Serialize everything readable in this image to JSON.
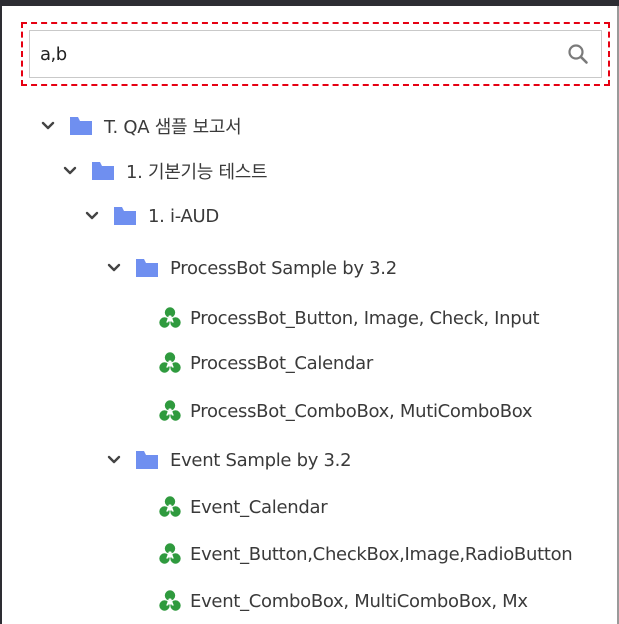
{
  "search": {
    "value": "a,b",
    "placeholder": ""
  },
  "colors": {
    "highlight": "#e60012",
    "folder": "#6f8ff0",
    "report_icon": "#2f9a3e",
    "text": "#3a3a3a"
  },
  "tree": {
    "items": [
      {
        "label": "T. QA 샘플 보고서",
        "type": "folder",
        "expanded": true
      },
      {
        "label": "1. 기본기능 테스트",
        "type": "folder",
        "expanded": true
      },
      {
        "label": "1. i-AUD",
        "type": "folder",
        "expanded": true
      },
      {
        "label": "ProcessBot Sample by 3.2",
        "type": "folder",
        "expanded": true
      },
      {
        "label": "ProcessBot_Button, Image, Check, Input",
        "type": "report"
      },
      {
        "label": "ProcessBot_Calendar",
        "type": "report"
      },
      {
        "label": "ProcessBot_ComboBox, MutiComboBox",
        "type": "report"
      },
      {
        "label": "Event Sample by 3.2",
        "type": "folder",
        "expanded": true
      },
      {
        "label": "Event_Calendar",
        "type": "report"
      },
      {
        "label": "Event_Button,CheckBox,Image,RadioButton",
        "type": "report"
      },
      {
        "label": "Event_ComboBox, MultiComboBox, Mx",
        "type": "report"
      }
    ]
  }
}
